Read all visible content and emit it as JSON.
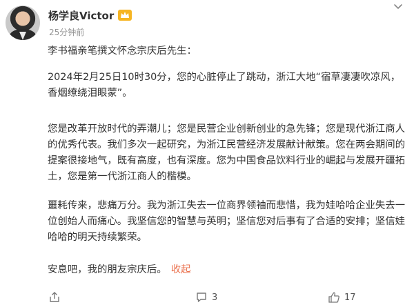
{
  "post": {
    "username": "杨学良Victor",
    "timestamp": "25分钟前",
    "intro": "李书福亲笔撰文怀念宗庆后先生：",
    "p1": "2024年2月25日10时30分，您的心脏停止了跳动，浙江大地“宿草凄凄吹凉风，香烟缭绕泪眼蒙”。",
    "p2": "您是改革开放时代的弄潮儿；您是民营企业创新创业的急先锋；您是现代浙江商人的优秀代表。我们多次一起研究，为浙江民营经济发展献计献策。您在两会期间的提案很接地气，既有高度，也有深度。您为中国食品饮料行业的崛起与发展开疆拓土，您是第一代浙江商人的楷模。",
    "p3": "噩耗传来，悲痛万分。我为浙江失去一位商界领袖而悲惜，我为娃哈哈企业失去一位创始人而痛心。我坚信您的智慧与英明；坚信您对后事有了合适的安排；坚信娃哈哈的明天持续繁荣。",
    "p4": "安息吧，我的朋友宗庆后。",
    "collapse_label": "收起"
  },
  "actions": {
    "share_count": "",
    "comment_count": "3",
    "like_count": "17"
  },
  "icons": {
    "vip": "vip-crown-badge",
    "more": "chevron-down-icon",
    "share": "share-icon",
    "comment": "comment-icon",
    "like": "like-icon"
  },
  "colors": {
    "link": "#eb7350",
    "badge": "#f6b523",
    "meta": "#939393"
  }
}
